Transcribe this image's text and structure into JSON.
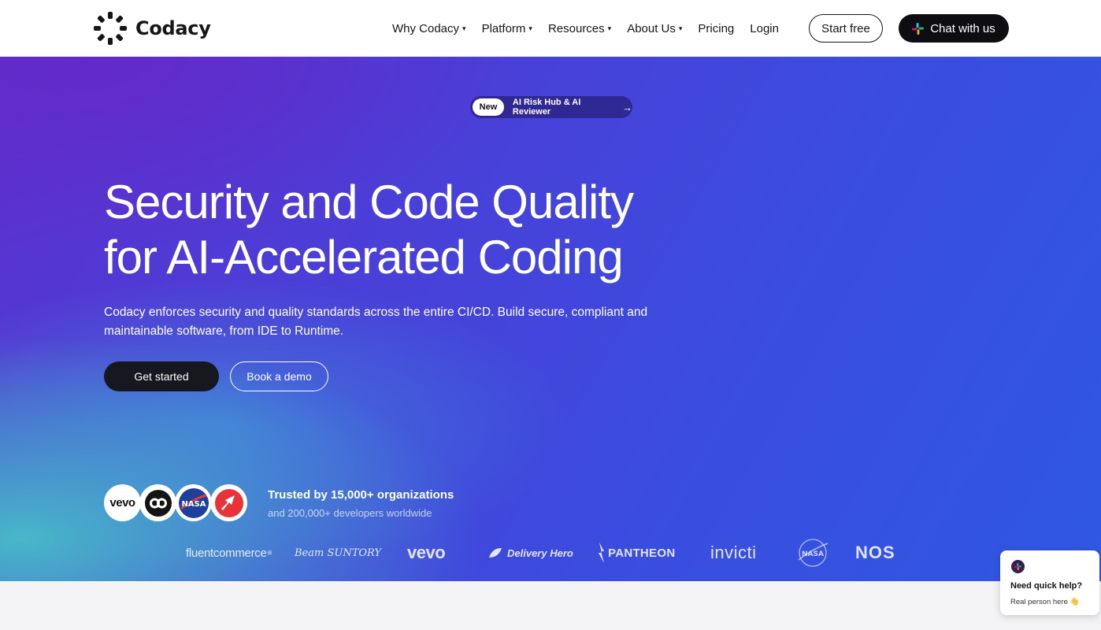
{
  "nav": {
    "brand": "Codacy",
    "menu": [
      {
        "label": "Why Codacy",
        "has_dropdown": true
      },
      {
        "label": "Platform",
        "has_dropdown": true
      },
      {
        "label": "Resources",
        "has_dropdown": true
      },
      {
        "label": "About Us",
        "has_dropdown": true
      },
      {
        "label": "Pricing",
        "has_dropdown": false
      },
      {
        "label": "Login",
        "has_dropdown": false
      }
    ],
    "caret": "▾",
    "start_free": "Start free",
    "chat": "Chat with us"
  },
  "hero": {
    "badge_new": "New",
    "badge_text": "AI Risk Hub & AI Reviewer",
    "badge_arrow": "→",
    "headline_line1": "Security and Code Quality",
    "headline_line2": "for AI-Accelerated Coding",
    "subcopy": "Codacy enforces security and quality standards across the entire CI/CD. Build secure, compliant and maintainable software, from IDE to Runtime.",
    "cta_primary": "Get started",
    "cta_secondary": "Book a demo"
  },
  "trust": {
    "avatars": [
      "vevo",
      "co",
      "NASA",
      "rocket"
    ],
    "headline": "Trusted by 15,000+ organizations",
    "sub": "and 200,000+ developers worldwide",
    "brands": [
      "fluentcommerce",
      "Beam SUNTORY",
      "vevo",
      "Delivery Hero",
      "PANTHEON",
      "invicti",
      "NASA",
      "NOS"
    ]
  },
  "help_widget": {
    "title": "Need quick help?",
    "sub": "Real person here 👋"
  },
  "colors": {
    "accent_dark": "#16171f",
    "hero_purple": "#5a32cf",
    "hero_blue": "#2f58e2",
    "hero_teal": "#46bec8"
  }
}
